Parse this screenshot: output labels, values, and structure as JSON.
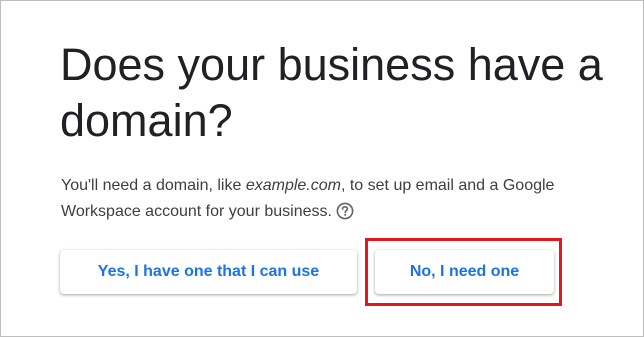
{
  "page": {
    "title": "Does your business have a domain?",
    "description": {
      "before": "You'll need a domain, like ",
      "example": "example.com",
      "after": ", to set up email and a Google Workspace account for your business."
    },
    "help_icon": "question-circle-icon"
  },
  "buttons": {
    "yes_label": "Yes, I have one that I can use",
    "no_label": "No, I need one"
  },
  "colors": {
    "accent": "#1a73e8",
    "highlight": "#e8141f",
    "title": "#202124"
  }
}
